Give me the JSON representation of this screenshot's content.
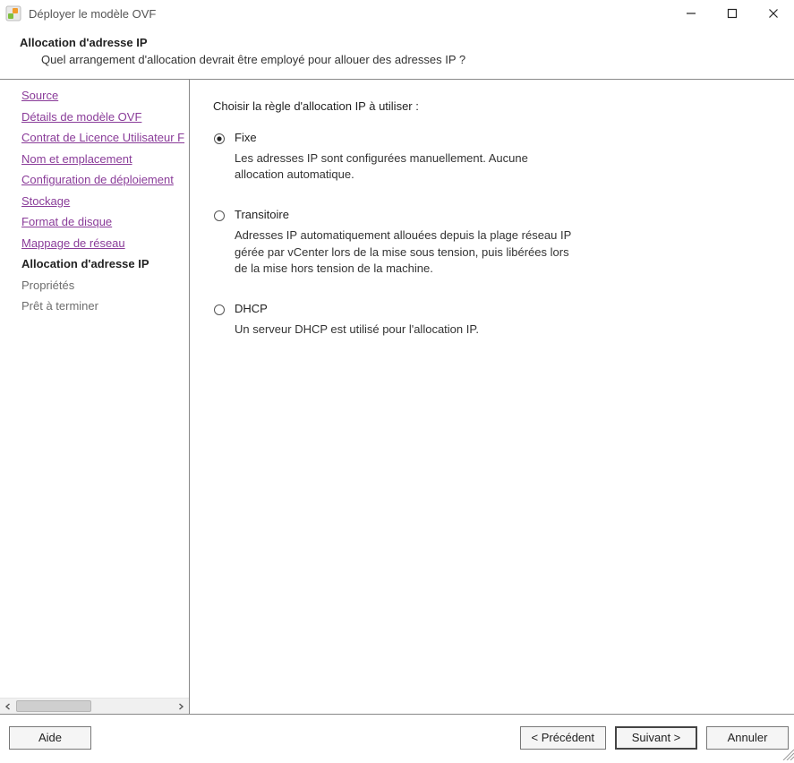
{
  "window": {
    "title": "Déployer le modèle OVF"
  },
  "header": {
    "title": "Allocation d'adresse IP",
    "subtitle": "Quel arrangement d'allocation devrait être employé pour allouer des adresses IP ?"
  },
  "nav": {
    "items": [
      {
        "label": "Source",
        "state": "link",
        "key": "source"
      },
      {
        "label": "Détails de modèle OVF",
        "state": "link",
        "key": "details"
      },
      {
        "label": "Contrat de Licence Utilisateur F",
        "state": "link",
        "key": "eula"
      },
      {
        "label": "Nom et emplacement",
        "state": "link",
        "key": "name"
      },
      {
        "label": "Configuration de déploiement",
        "state": "link",
        "key": "config"
      },
      {
        "label": "Stockage",
        "state": "link",
        "key": "storage"
      },
      {
        "label": "Format de disque",
        "state": "link",
        "key": "diskfmt"
      },
      {
        "label": "Mappage de réseau",
        "state": "link",
        "key": "netmap"
      },
      {
        "label": "Allocation d'adresse IP",
        "state": "current",
        "key": "ipalloc"
      },
      {
        "label": "Propriétés",
        "state": "disabled",
        "key": "props"
      },
      {
        "label": "Prêt à terminer",
        "state": "disabled",
        "key": "ready"
      }
    ]
  },
  "panel": {
    "prompt": "Choisir la règle d'allocation IP à utiliser :",
    "options": [
      {
        "key": "fixe",
        "label": "Fixe",
        "description": "Les adresses IP sont configurées manuellement. Aucune allocation automatique.",
        "selected": true
      },
      {
        "key": "transitoire",
        "label": "Transitoire",
        "description": "Adresses IP automatiquement allouées depuis la plage réseau IP gérée par vCenter lors de la mise sous tension, puis libérées lors de la mise hors tension de la machine.",
        "selected": false
      },
      {
        "key": "dhcp",
        "label": "DHCP",
        "description": "Un serveur DHCP est utilisé pour l'allocation IP.",
        "selected": false
      }
    ]
  },
  "footer": {
    "help": "Aide",
    "back": "< Précédent",
    "next": "Suivant >",
    "cancel": "Annuler"
  }
}
